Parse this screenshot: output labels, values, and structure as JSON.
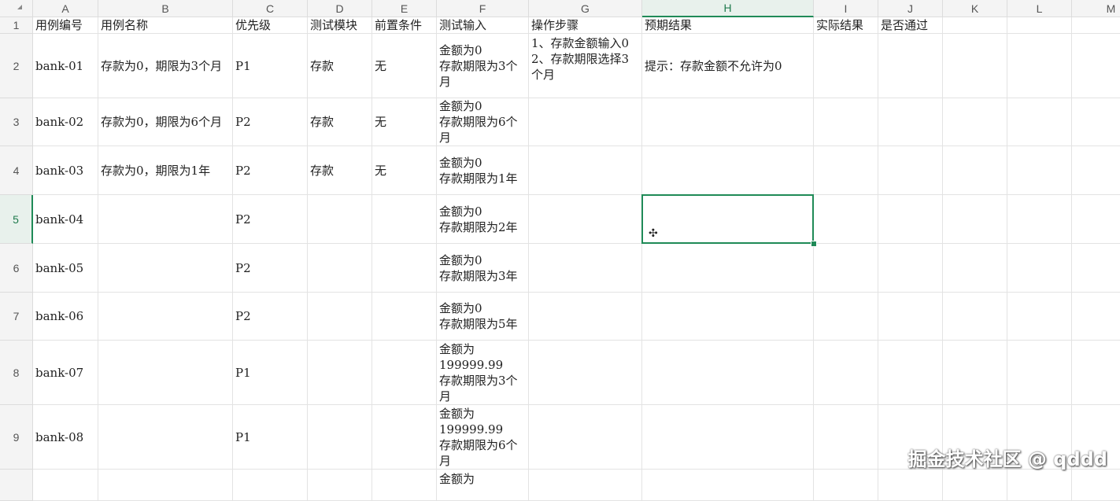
{
  "sheet": {
    "columns": [
      "A",
      "B",
      "C",
      "D",
      "E",
      "F",
      "G",
      "H",
      "I",
      "J",
      "K",
      "L",
      "M"
    ],
    "row_numbers": [
      "1",
      "2",
      "3",
      "4",
      "5",
      "6",
      "7",
      "8",
      "9"
    ],
    "selected_cell": "H5",
    "accent_color": "#1f8a57",
    "headers": [
      "用例编号",
      "用例名称",
      "优先级",
      "测试模块",
      "前置条件",
      "测试输入",
      "操作步骤",
      "预期结果",
      "实际结果",
      "是否通过"
    ],
    "rows": [
      {
        "id": "bank-01",
        "name": "存款为0，期限为3个月",
        "priority": "P1",
        "module": "存款",
        "precondition": "无",
        "input": "金额为0\n存款期限为3个月",
        "steps": "1、存款金额输入0\n2、存款期限选择3个月",
        "expected": "提示：存款金额不允许为0",
        "actual": "",
        "pass": ""
      },
      {
        "id": "bank-02",
        "name": "存款为0，期限为6个月",
        "priority": "P2",
        "module": "存款",
        "precondition": "无",
        "input": "金额为0\n存款期限为6个月",
        "steps": "",
        "expected": "",
        "actual": "",
        "pass": ""
      },
      {
        "id": "bank-03",
        "name": "存款为0，期限为1年",
        "priority": "P2",
        "module": "存款",
        "precondition": "无",
        "input": "金额为0\n存款期限为1年",
        "steps": "",
        "expected": "",
        "actual": "",
        "pass": ""
      },
      {
        "id": "bank-04",
        "name": "",
        "priority": "P2",
        "module": "",
        "precondition": "",
        "input": "金额为0\n存款期限为2年",
        "steps": "",
        "expected": "",
        "actual": "",
        "pass": ""
      },
      {
        "id": "bank-05",
        "name": "",
        "priority": "P2",
        "module": "",
        "precondition": "",
        "input": "金额为0\n存款期限为3年",
        "steps": "",
        "expected": "",
        "actual": "",
        "pass": ""
      },
      {
        "id": "bank-06",
        "name": "",
        "priority": "P2",
        "module": "",
        "precondition": "",
        "input": "金额为0\n存款期限为5年",
        "steps": "",
        "expected": "",
        "actual": "",
        "pass": ""
      },
      {
        "id": "bank-07",
        "name": "",
        "priority": "P1",
        "module": "",
        "precondition": "",
        "input": "金额为\n199999.99\n存款期限为3个月",
        "steps": "",
        "expected": "",
        "actual": "",
        "pass": ""
      },
      {
        "id": "bank-08",
        "name": "",
        "priority": "P1",
        "module": "",
        "precondition": "",
        "input": "金额为\n199999.99\n存款期限为6个月",
        "steps": "",
        "expected": "",
        "actual": "",
        "pass": ""
      }
    ],
    "partial_row": {
      "number": "",
      "input": "金额为"
    }
  },
  "watermark": "掘金技术社区 @ qddd"
}
